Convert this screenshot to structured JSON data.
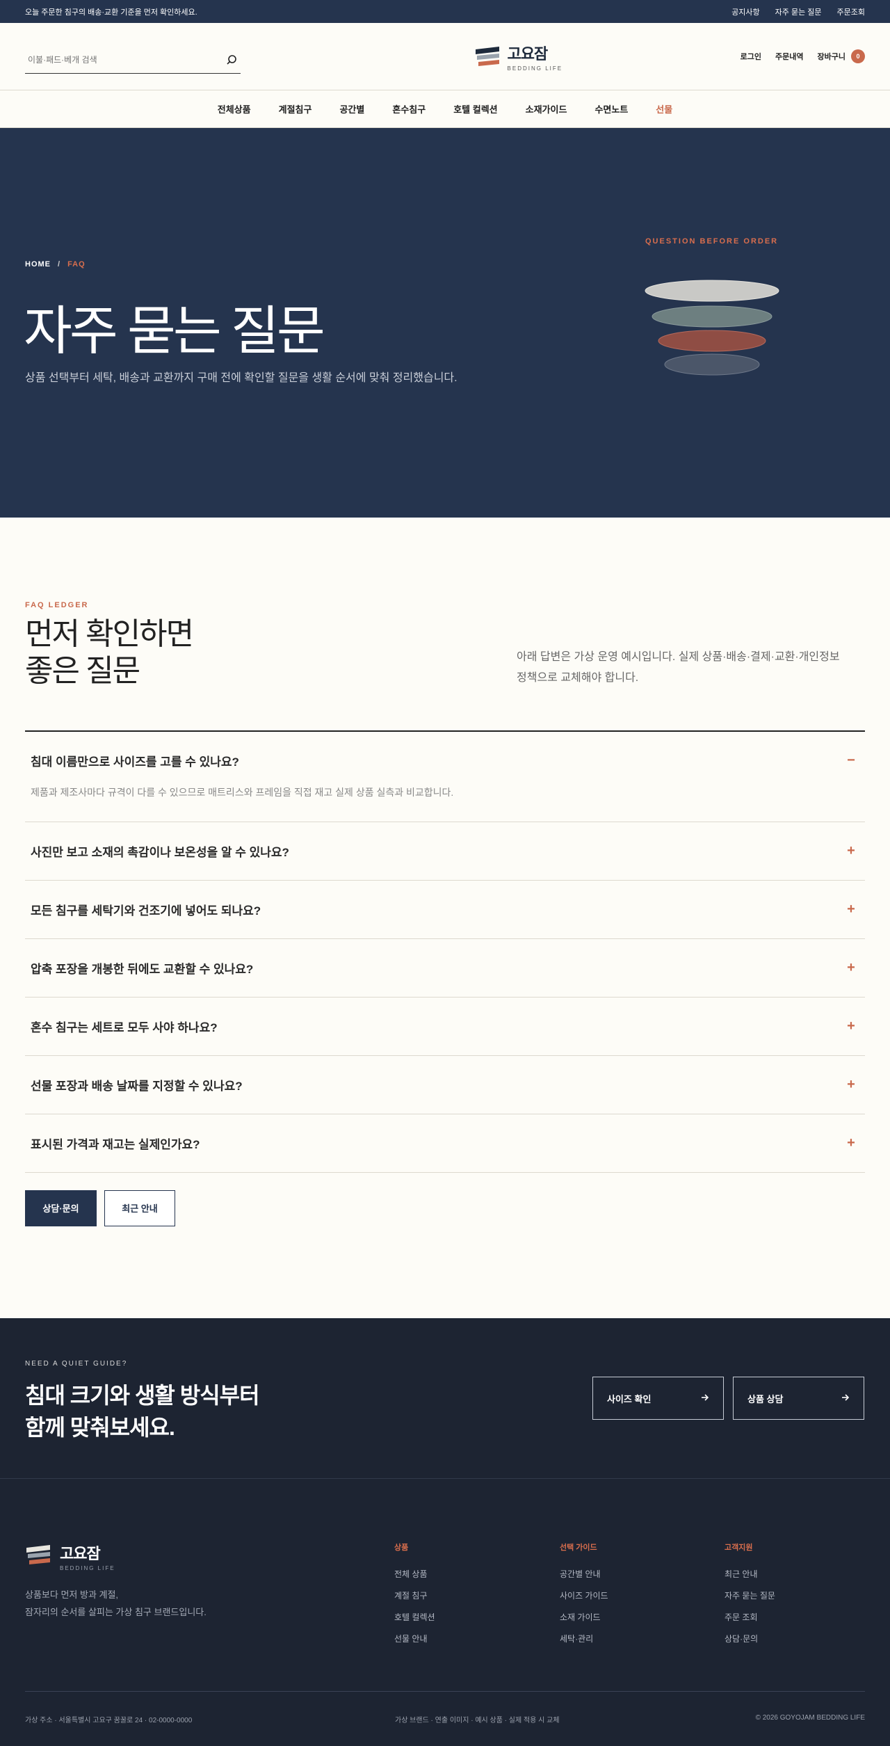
{
  "topbar": {
    "notice": "오늘 주문한 침구의 배송·교환 기준을 먼저 확인하세요.",
    "links": [
      "공지사항",
      "자주 묻는 질문",
      "주문조회"
    ]
  },
  "header": {
    "search_placeholder": "이불·패드·베개 검색",
    "logo_ko": "고요잠",
    "logo_en": "BEDDING LIFE",
    "login": "로그인",
    "orders": "주문내역",
    "cart": "장바구니",
    "cart_count": "0"
  },
  "nav": [
    "전체상품",
    "계절침구",
    "공간별",
    "혼수침구",
    "호텔 컬렉션",
    "소재가이드",
    "수면노트",
    "선물"
  ],
  "hero": {
    "crumb_home": "HOME",
    "crumb_sep": "/",
    "crumb_current": "FAQ",
    "title": "자주 묻는 질문",
    "subtitle": "상품 선택부터 세탁, 배송과 교환까지 구매 전에 확인할 질문을 생활 순서에 맞춰 정리했습니다.",
    "eyebrow": "QUESTION BEFORE ORDER"
  },
  "faq": {
    "label": "FAQ LEDGER",
    "title_line1": "먼저 확인하면",
    "title_line2": "좋은 질문",
    "desc": "아래 답변은 가상 운영 예시입니다. 실제 상품·배송·결제·교환·개인정보 정책으로 교체해야 합니다.",
    "open_answer": "제품과 제조사마다 규격이 다를 수 있으므로 매트리스와 프레임을 직접 재고 실제 상품 실측과 비교합니다.",
    "items": [
      {
        "q": "침대 이름만으로 사이즈를 고를 수 있나요?",
        "toggle": "−"
      },
      {
        "q": "사진만 보고 소재의 촉감이나 보온성을 알 수 있나요?",
        "toggle": "+"
      },
      {
        "q": "모든 침구를 세탁기와 건조기에 넣어도 되나요?",
        "toggle": "+"
      },
      {
        "q": "압축 포장을 개봉한 뒤에도 교환할 수 있나요?",
        "toggle": "+"
      },
      {
        "q": "혼수 침구는 세트로 모두 사야 하나요?",
        "toggle": "+"
      },
      {
        "q": "선물 포장과 배송 날짜를 지정할 수 있나요?",
        "toggle": "+"
      },
      {
        "q": "표시된 가격과 재고는 실제인가요?",
        "toggle": "+"
      }
    ],
    "btn_contact": "상담·문의",
    "btn_notice": "최근 안내"
  },
  "cta": {
    "eyebrow": "NEED A QUIET GUIDE?",
    "title_line1": "침대 크기와 생활 방식부터",
    "title_line2": "함께 맞춰보세요.",
    "btn_size": "사이즈 확인",
    "btn_consult": "상품 상담"
  },
  "footer": {
    "logo_ko": "고요잠",
    "logo_en": "BEDDING LIFE",
    "desc_line1": "상품보다 먼저 방과 계절,",
    "desc_line2": "잠자리의 순서를 살피는 가상 침구 브랜드입니다.",
    "columns": [
      {
        "title": "상품",
        "items": [
          "전체 상품",
          "계절 침구",
          "호텔 컬렉션",
          "선물 안내"
        ]
      },
      {
        "title": "선택 가이드",
        "items": [
          "공간별 안내",
          "사이즈 가이드",
          "소재 가이드",
          "세탁·관리"
        ]
      },
      {
        "title": "고객지원",
        "items": [
          "최근 안내",
          "자주 묻는 질문",
          "주문 조회",
          "상담·문의"
        ]
      }
    ],
    "address": "가상 주소 · 서울특별시 고요구 꿈꿀로 24 · 02-0000-0000",
    "note": "가상 브랜드 · 연출 이미지 · 예시 상품 · 실제 적용 시 교체",
    "copyright": "© 2026 GOYOJAM BEDDING LIFE"
  },
  "colors": {
    "navy": "#25344e",
    "accent": "#c9694c",
    "dark_footer": "#1d2432",
    "background": "#fdfcf7"
  }
}
